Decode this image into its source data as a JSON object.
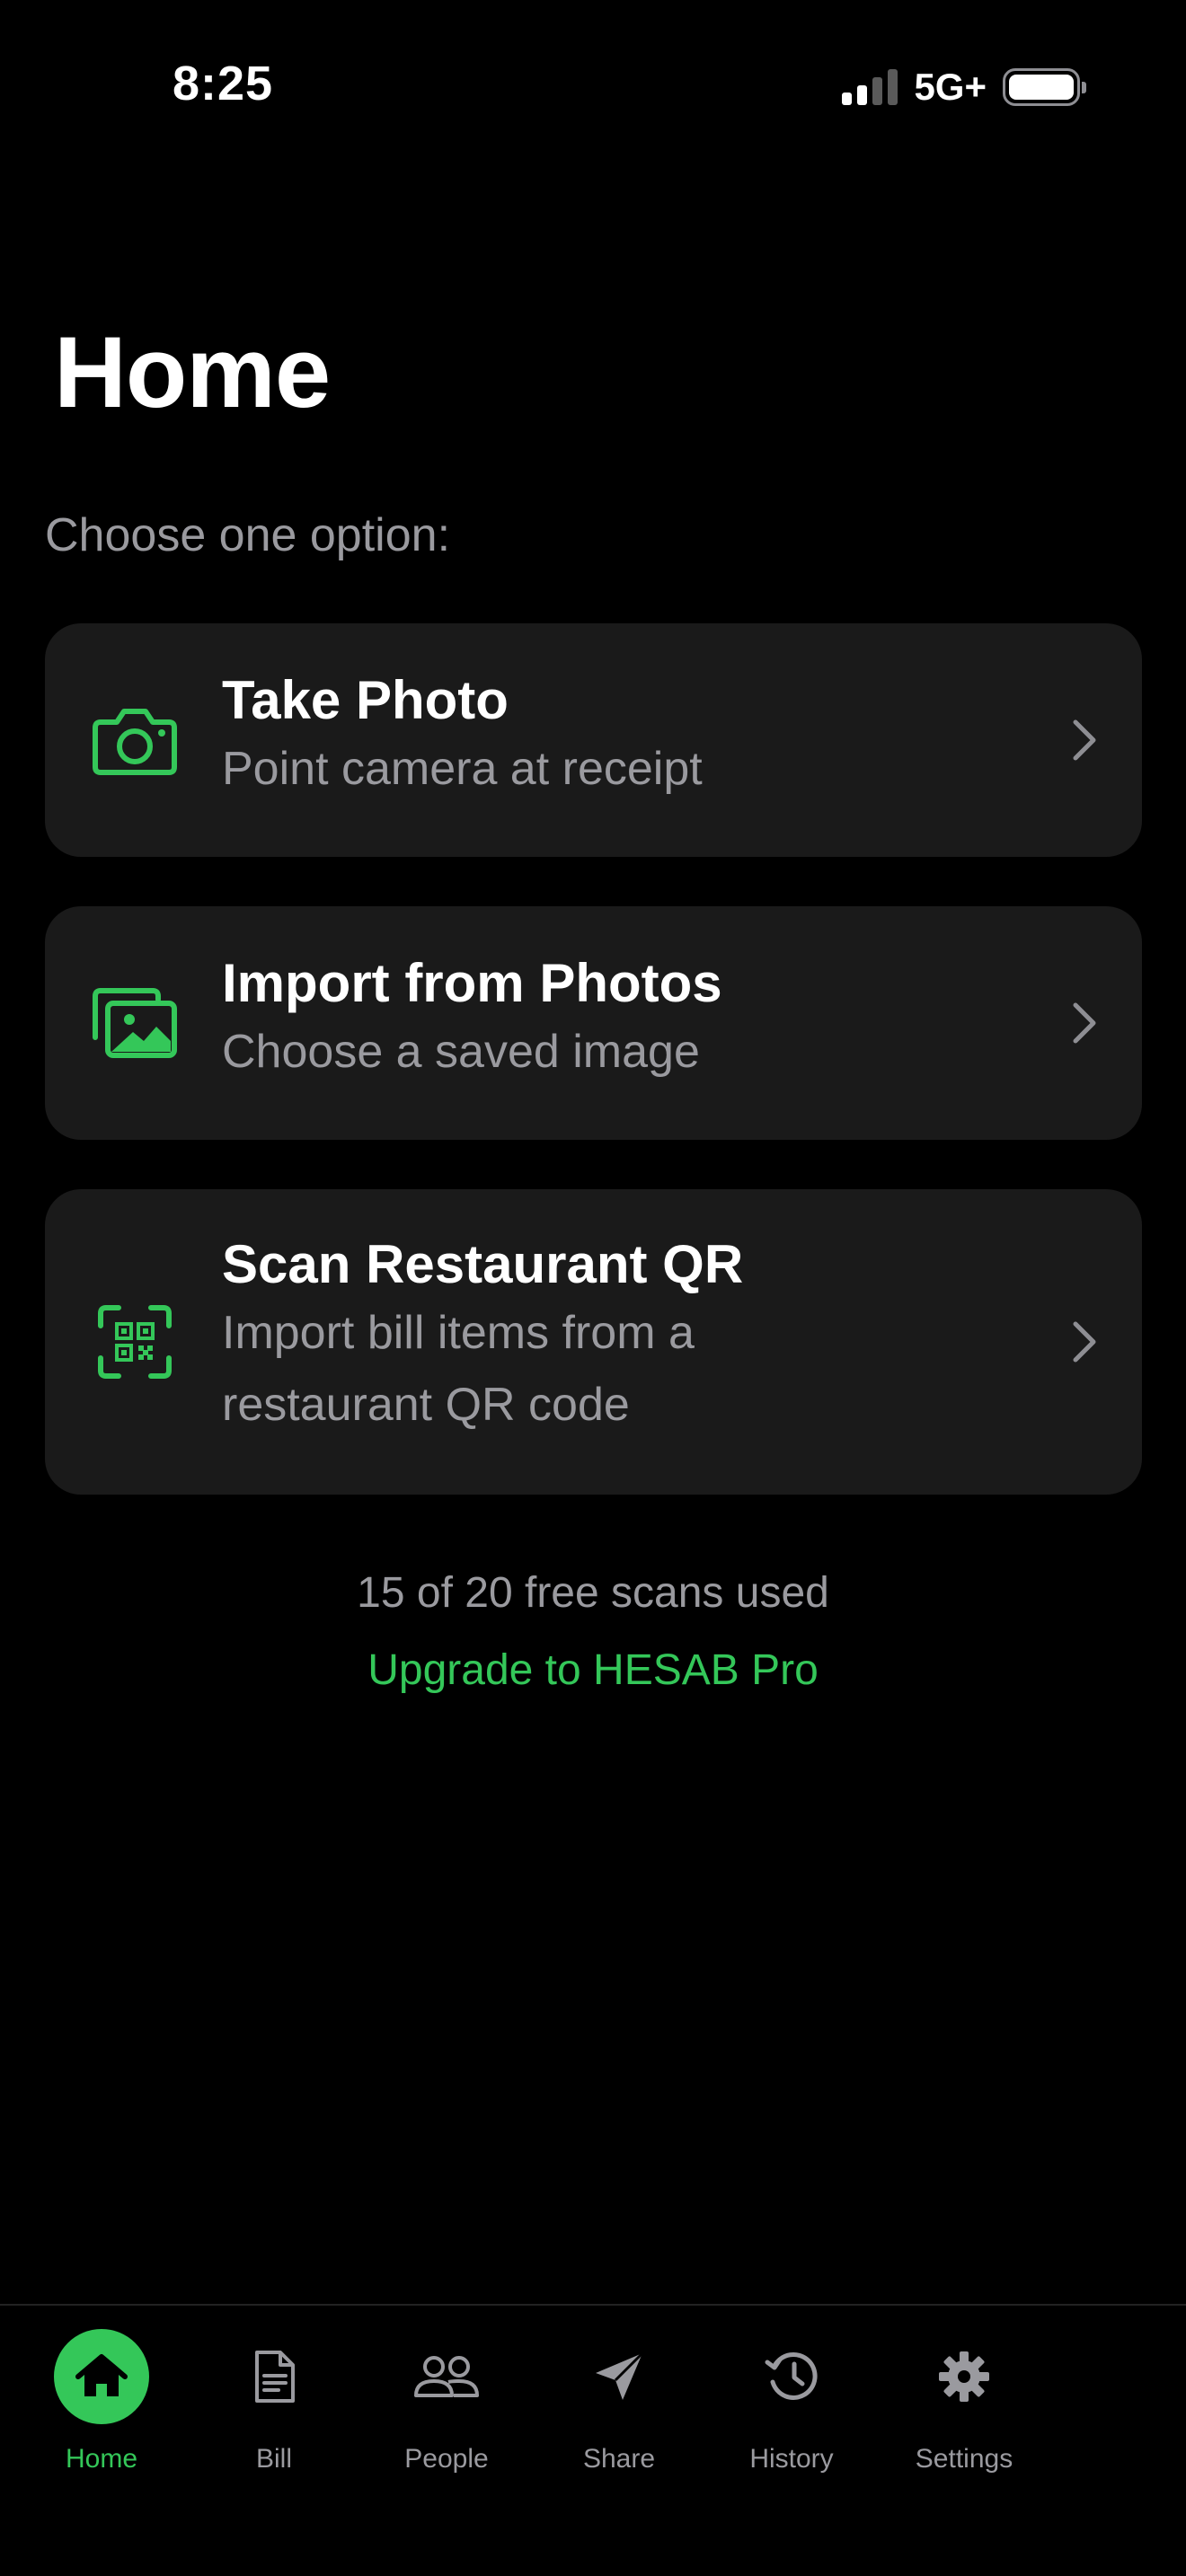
{
  "status_bar": {
    "time": "8:25",
    "network": "5G+",
    "battery_level": 1.0
  },
  "header": {
    "title": "Home"
  },
  "prompt": "Choose one option:",
  "options": [
    {
      "title": "Take Photo",
      "subtitle": "Point camera at receipt",
      "icon": "camera-icon"
    },
    {
      "title": "Import from Photos",
      "subtitle": "Choose a saved image",
      "icon": "photos-icon"
    },
    {
      "title": "Scan Restaurant QR",
      "subtitle_line1": "Import bill items from a",
      "subtitle_line2": "restaurant QR code",
      "icon": "qr-scan-icon"
    }
  ],
  "usage": {
    "text": "15 of 20 free scans used",
    "upgrade_label": "Upgrade to HESAB Pro"
  },
  "tab_bar": {
    "active": "Home",
    "tabs": [
      {
        "label": "Home",
        "icon": "home-icon"
      },
      {
        "label": "Bill",
        "icon": "document-icon"
      },
      {
        "label": "People",
        "icon": "people-icon"
      },
      {
        "label": "Share",
        "icon": "paper-plane-icon"
      },
      {
        "label": "History",
        "icon": "history-icon"
      },
      {
        "label": "Settings",
        "icon": "gear-icon"
      }
    ]
  },
  "colors": {
    "accent": "#34c759",
    "background": "#000000",
    "card": "#1a1a1a",
    "secondary_text": "#9a9a9f"
  }
}
